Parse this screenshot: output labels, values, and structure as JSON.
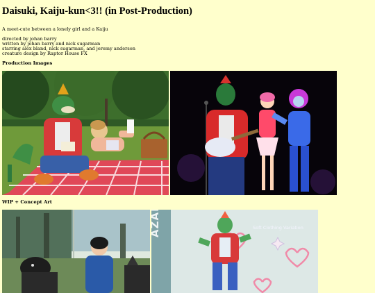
{
  "page": {
    "title": "Daisuki, Kaiju-kun<3!! (in Post-Production)",
    "tagline": "A meet-cute between a lonely girl and a Kaiju",
    "credits": [
      "directed by johan barry",
      "written by johan barry and nick sugarman",
      "starring alex bland, nick sugarman, and jeremy anderson",
      "creature design by Raptor House FX"
    ]
  },
  "sections": {
    "production": {
      "heading": "Production Images",
      "images": [
        {
          "name": "picnic-still",
          "subject": "kaiju costume and girl on picnic blanket in a park"
        },
        {
          "name": "stage-still",
          "subject": "kaiju with guitar performing on stage with two performers"
        }
      ]
    },
    "concept": {
      "heading": "WIP + Concept Art",
      "images": [
        {
          "name": "magazine-concept",
          "subject": "magazine spread with kaiju and girl"
        },
        {
          "name": "clothing-concept",
          "subject": "kaiju clothing variation sketch",
          "caption": "Soft Clothing Variation",
          "side_text": "AZAM"
        }
      ]
    }
  },
  "colors": {
    "background": "#ffffcc",
    "kaiju_green": "#3f8f45",
    "jacket_red": "#d83a3a",
    "blanket_red": "#e04858"
  }
}
